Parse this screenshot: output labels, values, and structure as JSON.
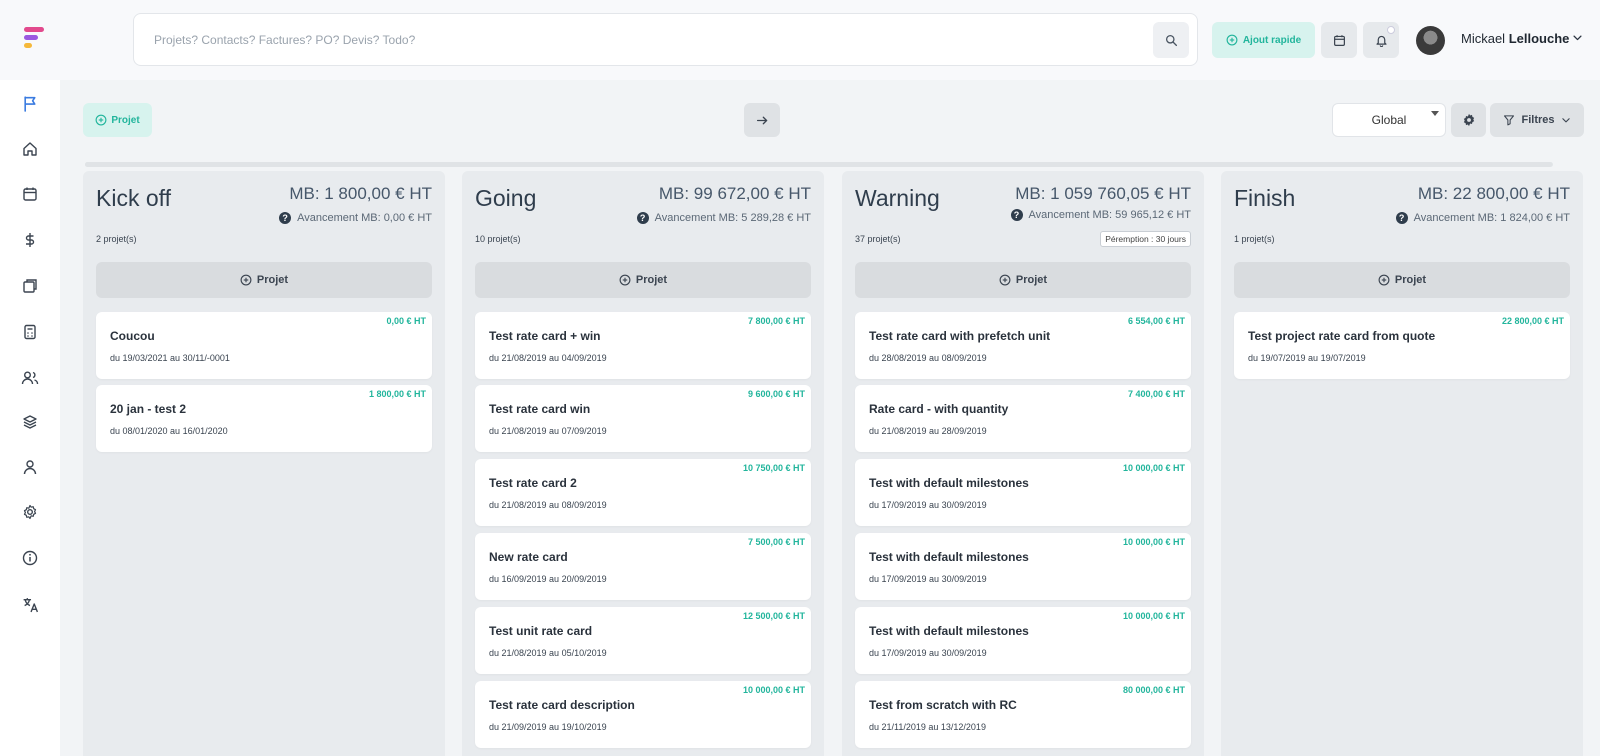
{
  "header": {
    "search_placeholder": "Projets? Contacts? Factures? PO? Devis? Todo?",
    "quick_add_label": "Ajout rapide",
    "user_first": "Mickael",
    "user_last": "Lellouche"
  },
  "toolbar": {
    "add_project_label": "Projet",
    "scope_value": "Global",
    "filters_label": "Filtres"
  },
  "colors": {
    "accent": "#22b59c",
    "accent_bg": "#d7f3ee"
  },
  "sidebar": {
    "icons": [
      "flag-icon",
      "home-icon",
      "calendar-icon",
      "dollar-icon",
      "folders-icon",
      "calculator-icon",
      "users-icon",
      "layers-icon",
      "user-icon",
      "settings-icon",
      "info-icon",
      "translate-icon"
    ]
  },
  "columns": [
    {
      "title": "Kick off",
      "mb": "MB: 1 800,00 € HT",
      "avancement": "Avancement MB: 0,00 € HT",
      "count": "2 projet(s)",
      "add_label": "Projet",
      "cards": [
        {
          "amount": "0,00 € HT",
          "name": "Coucou",
          "dates": "du 19/03/2021 au 30/11/-0001"
        },
        {
          "amount": "1 800,00 € HT",
          "name": "20 jan - test 2",
          "dates": "du 08/01/2020 au 16/01/2020"
        }
      ]
    },
    {
      "title": "Going",
      "mb": "MB: 99 672,00 € HT",
      "avancement": "Avancement MB: 5 289,28 € HT",
      "count": "10 projet(s)",
      "add_label": "Projet",
      "cards": [
        {
          "amount": "7 800,00 € HT",
          "name": "Test rate card + win",
          "dates": "du 21/08/2019 au 04/09/2019"
        },
        {
          "amount": "9 600,00 € HT",
          "name": "Test rate card win",
          "dates": "du 21/08/2019 au 07/09/2019"
        },
        {
          "amount": "10 750,00 € HT",
          "name": "Test rate card 2",
          "dates": "du 21/08/2019 au 08/09/2019"
        },
        {
          "amount": "7 500,00 € HT",
          "name": "New rate card",
          "dates": "du 16/09/2019 au 20/09/2019"
        },
        {
          "amount": "12 500,00 € HT",
          "name": "Test unit rate card",
          "dates": "du 21/08/2019 au 05/10/2019"
        },
        {
          "amount": "10 000,00 € HT",
          "name": "Test rate card description",
          "dates": "du 21/09/2019 au 19/10/2019"
        }
      ]
    },
    {
      "title": "Warning",
      "mb": "MB: 1 059 760,05 € HT",
      "avancement": "Avancement MB: 59 965,12 € HT",
      "count": "37 projet(s)",
      "peremption": "Péremption : 30 jours",
      "add_label": "Projet",
      "cards": [
        {
          "amount": "6 554,00 € HT",
          "name": "Test rate card with prefetch unit",
          "dates": "du 28/08/2019 au 08/09/2019"
        },
        {
          "amount": "7 400,00 € HT",
          "name": "Rate card - with quantity",
          "dates": "du 21/08/2019 au 28/09/2019"
        },
        {
          "amount": "10 000,00 € HT",
          "name": "Test with default milestones",
          "dates": "du 17/09/2019 au 30/09/2019"
        },
        {
          "amount": "10 000,00 € HT",
          "name": "Test with default milestones",
          "dates": "du 17/09/2019 au 30/09/2019"
        },
        {
          "amount": "10 000,00 € HT",
          "name": "Test with default milestones",
          "dates": "du 17/09/2019 au 30/09/2019"
        },
        {
          "amount": "80 000,00 € HT",
          "name": "Test from scratch with RC",
          "dates": "du 21/11/2019 au 13/12/2019"
        }
      ]
    },
    {
      "title": "Finish",
      "mb": "MB: 22 800,00 € HT",
      "avancement": "Avancement MB: 1 824,00 € HT",
      "count": "1 projet(s)",
      "add_label": "Projet",
      "cards": [
        {
          "amount": "22 800,00 € HT",
          "name": "Test project rate card from quote",
          "dates": "du 19/07/2019 au 19/07/2019"
        }
      ]
    }
  ]
}
